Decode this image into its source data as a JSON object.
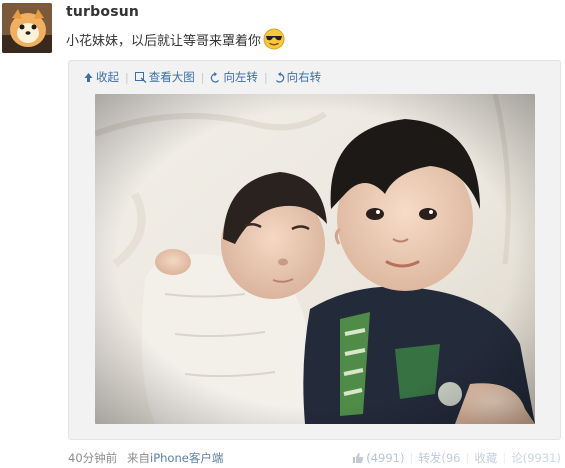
{
  "post": {
    "username": "turbosun",
    "text": "小花妹妹，以后就让等哥来罩着你",
    "emoji": "cool-face-sunglasses"
  },
  "toolbar": {
    "collapse": "收起",
    "view_large": "查看大图",
    "rotate_left": "向左转",
    "rotate_right": "向右转",
    "icons": [
      "arrow-up-icon",
      "magnify-icon",
      "rotate-left-icon",
      "rotate-right-icon"
    ]
  },
  "footer": {
    "time": "40分钟前",
    "source_prefix": "来自",
    "source_client": "iPhone客户端",
    "like_count": "(4991)",
    "repost_label": "转发(96",
    "favorite_label": "收藏",
    "comment_count": "论(9931)"
  },
  "colors": {
    "link": "#3b6fa7",
    "muted": "#8c8c8c",
    "media_bg": "#f2f2f2"
  }
}
